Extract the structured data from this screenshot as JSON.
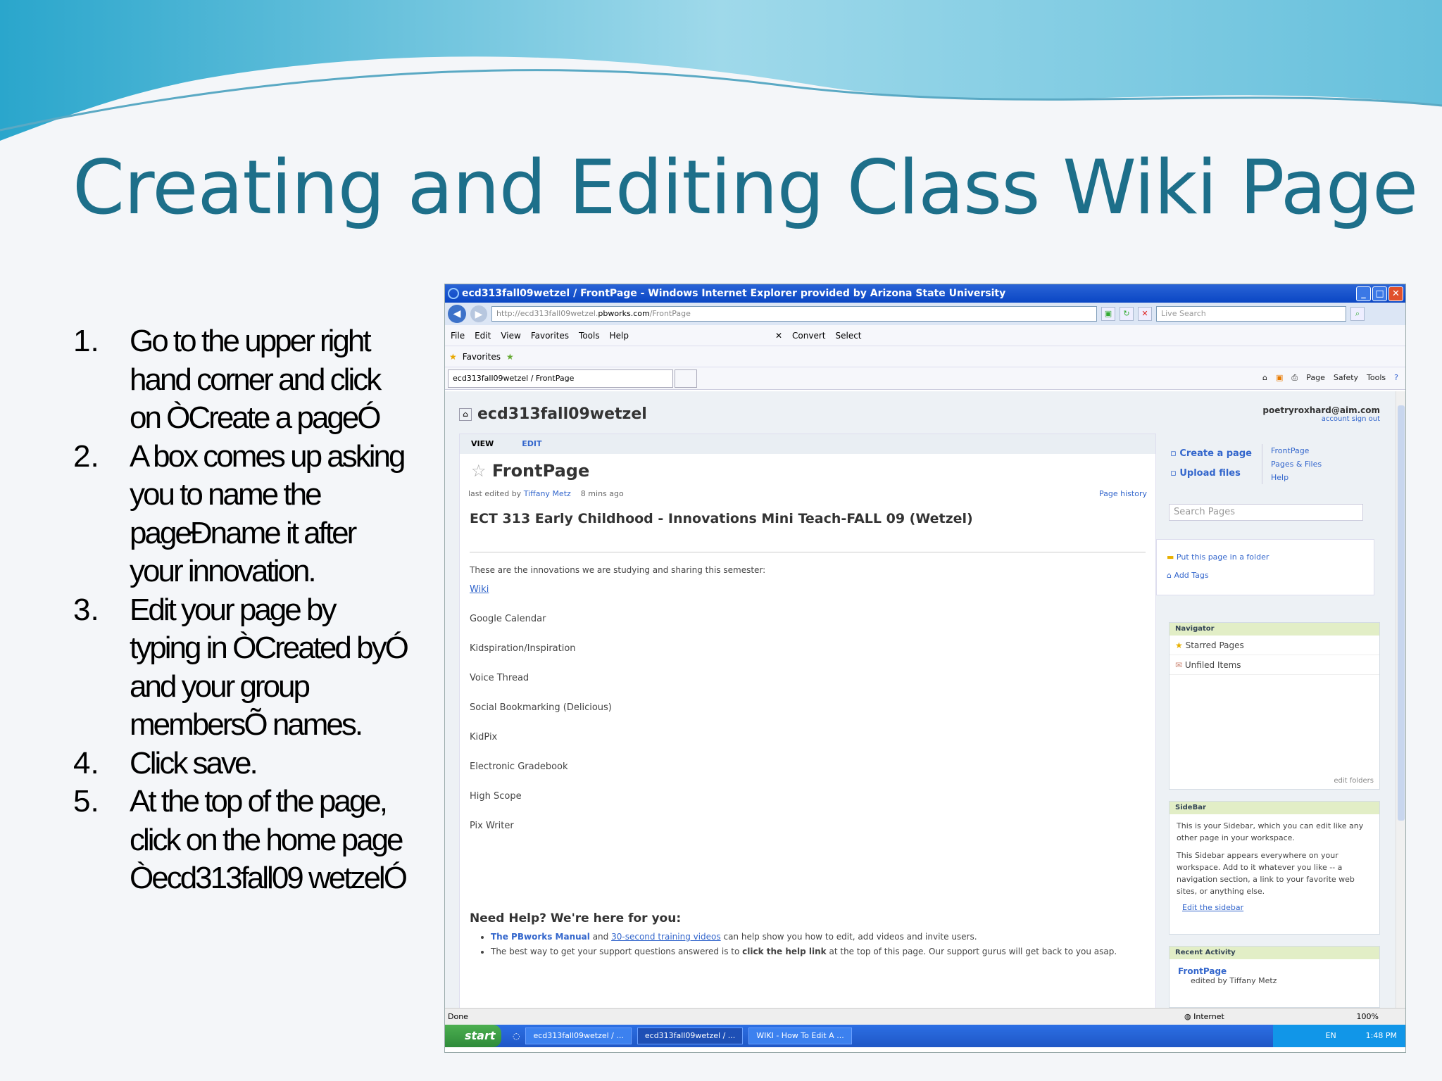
{
  "slide": {
    "title": "Creating and Editing Class Wiki Page",
    "steps": [
      {
        "num": "1.",
        "text": "Go to the upper right hand corner and click on ÒCreate a pageÓ"
      },
      {
        "num": "2.",
        "text": "A box comes up asking you to name the pageÐname it after your innovation."
      },
      {
        "num": "3.",
        "text": "Edit your page by typing in ÒCreated byÓ and your group membersÕ names."
      },
      {
        "num": "4.",
        "text": "Click save."
      },
      {
        "num": "5.",
        "text": "At the top of the page, click on the home page Òecd313fall09 wetzelÓ"
      }
    ]
  },
  "browser": {
    "window_title": "ecd313fall09wetzel / FrontPage - Windows Internet Explorer provided by Arizona State University",
    "address_pre": "http://ecd313fall09wetzel.",
    "address_domain": "pbworks.com",
    "address_post": "/FrontPage",
    "live_search": "Live Search",
    "menu": [
      "File",
      "Edit",
      "View",
      "Favorites",
      "Tools",
      "Help"
    ],
    "convert": "Convert",
    "select": "Select",
    "favorites": "Favorites",
    "tab_label": "ecd313fall09wetzel / FrontPage",
    "commands": [
      "Page",
      "Safety",
      "Tools"
    ],
    "status": "Done",
    "zone": "Internet",
    "zoom": "100%"
  },
  "wiki": {
    "workspace": "ecd313fall09wetzel",
    "user": "poetryroxhard@aim.com",
    "account": "account",
    "sign_out": "sign out",
    "tab_view": "VIEW",
    "tab_edit": "EDIT",
    "page_title": "FrontPage",
    "last_edited": "last edited by",
    "editor": "Tiffany Metz",
    "edited_time": "8 mins ago",
    "page_history": "Page history",
    "headline": "ECT 313 Early Childhood - Innovations Mini Teach-FALL 09 (Wetzel)",
    "intro": "These are the innovations we are studying and sharing this semester:",
    "innovations": [
      "Wiki",
      "Google Calendar",
      "Kidspiration/Inspiration",
      "Voice Thread",
      "Social Bookmarking (Delicious)",
      "KidPix",
      "Electronic Gradebook",
      "High Scope",
      "Pix Writer"
    ],
    "help_heading": "Need Help? We're here for you:",
    "help_manual": "The PBworks Manual",
    "help_and": "and",
    "help_videos": "30-second training videos",
    "help_line1_end": "can help show you how to edit, add videos and invite users.",
    "help_line2_start": "The best way to get your support questions answered is to",
    "help_line2_bold": "click the help link",
    "help_line2_end": "at the top of this page.  Our support gurus will get back to you asap.",
    "create_page": "Create a page",
    "upload_files": "Upload files",
    "side_links": [
      "FrontPage",
      "Pages & Files",
      "Help"
    ],
    "search_pages": "Search Pages",
    "put_in_folder": "Put this page in a folder",
    "add_tags": "Add Tags",
    "navigator": "Navigator",
    "starred_pages": "Starred Pages",
    "unfiled_items": "Unfiled Items",
    "edit_folders": "edit folders",
    "sidebar_h": "SideBar",
    "sidebar_text1": "This is your Sidebar, which you can edit like any other page in your workspace.",
    "sidebar_text2": "This Sidebar appears everywhere on your workspace. Add to it whatever you like -- a navigation section, a link to your favorite web sites, or anything else.",
    "edit_sidebar": "Edit the sidebar",
    "recent_activity": "Recent Activity",
    "recent_page": "FrontPage",
    "recent_edited": "edited by Tiffany Metz"
  },
  "taskbar": {
    "start": "start",
    "tasks": [
      "ecd313fall09wetzel / ...",
      "ecd313fall09wetzel / ...",
      "WIKI - How To Edit A ..."
    ],
    "lang": "EN",
    "time": "1:48 PM"
  },
  "colors": {
    "title": "#1d6f8a",
    "wave": "#7cc8e0"
  }
}
